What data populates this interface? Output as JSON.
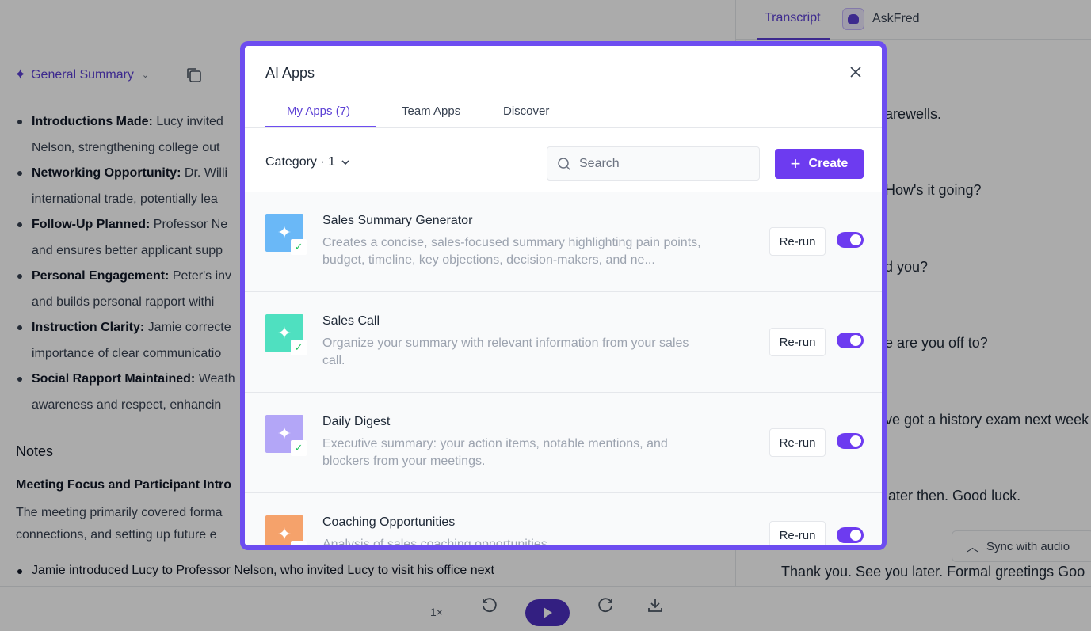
{
  "summary": {
    "title": "General Summary",
    "bullets": [
      {
        "label": "Introductions Made:",
        "text": " Lucy invited"
      },
      {
        "label": "",
        "text": "Nelson, strengthening college out"
      },
      {
        "label": "Networking Opportunity:",
        "text": " Dr. Willi"
      },
      {
        "label": "",
        "text": "international trade, potentially lea"
      },
      {
        "label": "Follow-Up Planned:",
        "text": " Professor Ne"
      },
      {
        "label": "",
        "text": "and ensures better applicant supp"
      },
      {
        "label": "Personal Engagement:",
        "text": " Peter's inv"
      },
      {
        "label": "",
        "text": "and builds personal rapport withi"
      },
      {
        "label": "Instruction Clarity:",
        "text": " Jamie correcte"
      },
      {
        "label": "",
        "text": "importance of clear communicatio"
      },
      {
        "label": "Social Rapport Maintained:",
        "text": " Weath"
      },
      {
        "label": "",
        "text": "awareness and respect, enhancin"
      }
    ],
    "notes_title": "Notes",
    "notes_subtitle": "Meeting Focus and Participant Intro",
    "notes_line1": "The meeting primarily covered forma",
    "notes_line2": "connections, and setting up future e",
    "notes_bullet": "Jamie introduced Lucy to Professor Nelson, who invited Lucy to visit his office next"
  },
  "transcript": {
    "tab_transcript": "Transcript",
    "tab_askfred": "AskFred",
    "lines": [
      "arewells.",
      "How's it going?",
      "d you?",
      "e are you off to?",
      "ve got a history exam next week",
      "later then. Good luck.",
      "Thank you. See you later. Formal greetings Goo"
    ],
    "sync_label": "Sync with audio"
  },
  "player": {
    "speed": "1×"
  },
  "modal": {
    "title": "AI Apps",
    "tabs": [
      {
        "label": "My Apps (7)",
        "active": true
      },
      {
        "label": "Team Apps",
        "active": false
      },
      {
        "label": "Discover",
        "active": false
      }
    ],
    "category_label": "Category · 1",
    "search_placeholder": "Search",
    "create_label": "Create",
    "rerun_label": "Re-run",
    "apps": [
      {
        "name": "Sales Summary Generator",
        "desc": "Creates a concise, sales-focused summary highlighting pain points, budget, timeline, key objections, decision-makers, and ne...",
        "color": "#6ab8f7",
        "enabled": true
      },
      {
        "name": "Sales Call",
        "desc": "Organize your summary with relevant information from your sales call.",
        "color": "#4fe0c0",
        "enabled": true
      },
      {
        "name": "Daily Digest",
        "desc": "Executive summary: your action items, notable mentions, and blockers from your meetings.",
        "color": "#b3a6f7",
        "enabled": true
      },
      {
        "name": "Coaching Opportunities",
        "desc": "Analysis of sales coaching opportunities",
        "color": "#f5a26b",
        "enabled": true
      }
    ]
  },
  "colors": {
    "accent": "#6d3bf0",
    "frame": "#6d4df0",
    "link": "#5b3fd4"
  }
}
